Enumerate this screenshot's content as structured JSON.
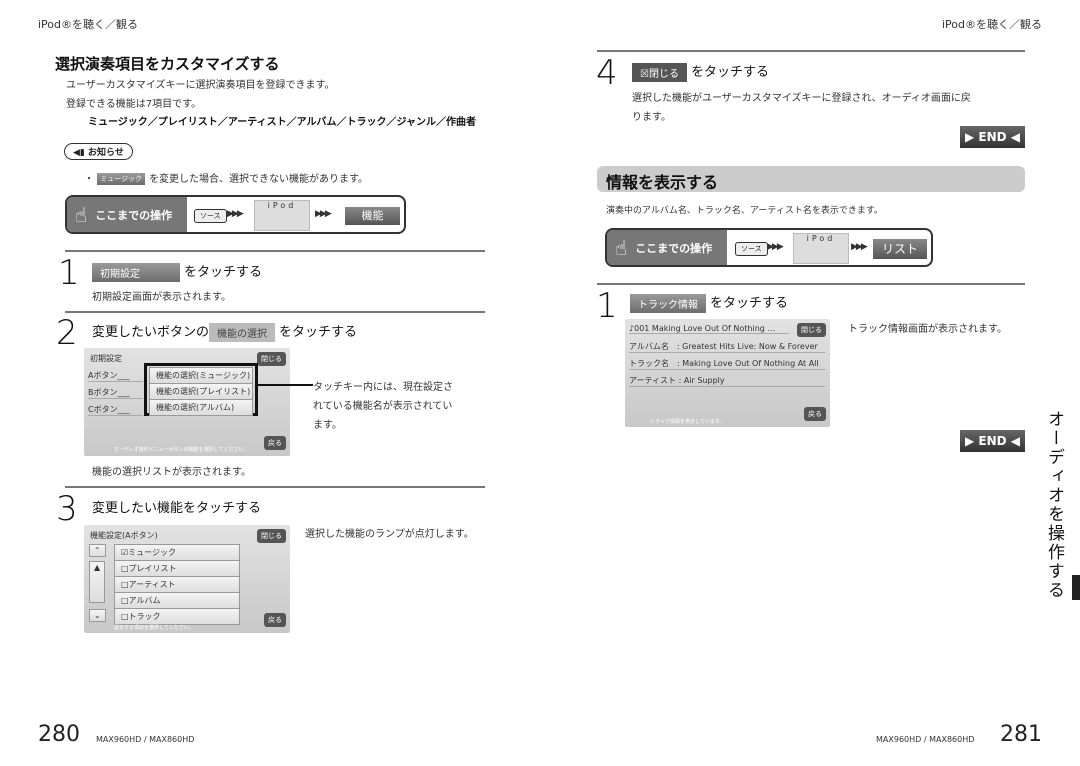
{
  "header": {
    "left": "iPod®を聴く／観る",
    "right": "iPod®を聴く／観る"
  },
  "left": {
    "title": "選択演奏項目をカスタマイズする",
    "intro1": "ユーザーカスタマイズキーに選択演奏項目を登録できます。",
    "intro2": "登録できる機能は7項目です。",
    "functions": "ミュージック／プレイリスト／アーティスト／アルバム／トラック／ジャンル／作曲者",
    "notice_label": "お知らせ",
    "notice_chip": "ミュージック",
    "notice_text": "を変更した場合、選択できない機能があります。",
    "op": {
      "label": "ここまでの操作",
      "source": "ソース",
      "ipod": "iPod",
      "dest": "機能"
    },
    "step1": {
      "num": "1",
      "chip": "初期設定",
      "text": "をタッチする",
      "desc": "初期設定画面が表示されます。"
    },
    "step2": {
      "num": "2",
      "pre": "変更したいボタンの",
      "chip": "機能の選択",
      "text": "をタッチする",
      "desc": "機能の選択リストが表示されます。",
      "callout": [
        "タッチキー内には、現在設定さ",
        "れている機能名が表示されてい",
        "ます。"
      ]
    },
    "screen1": {
      "title": "初期設定",
      "close": "閉じる",
      "rows": [
        "Aボタン___",
        "Bボタン___",
        "Cボタン___"
      ],
      "buttons": [
        "機能の選択(ミュージック)",
        "機能の選択(プレイリスト)",
        "機能の選択(アルバム)"
      ],
      "back": "戻る",
      "hint": "オーディオ操作メニューボタンの機能を選択してください。"
    },
    "step3": {
      "num": "3",
      "text": "変更したい機能をタッチする",
      "desc": "選択した機能のランプが点灯します。"
    },
    "screen2": {
      "title": "機能設定(Aボタン)",
      "close": "閉じる",
      "items": [
        "☑ミュージック",
        "□プレイリスト",
        "□アーティスト",
        "□アルバム",
        "□トラック"
      ],
      "back": "戻る",
      "hint": "設定する項目を選択してください。"
    },
    "page_num": "280",
    "model": "MAX960HD / MAX860HD"
  },
  "right": {
    "step4": {
      "num": "4",
      "chip": "閉じる",
      "text": "をタッチする",
      "desc1": "選択した機能がユーザーカスタマイズキーに登録され、オーディオ画面に戻",
      "desc2": "ります。"
    },
    "end1": "END",
    "section_title": "情報を表示する",
    "intro": "演奏中のアルバム名、トラック名、アーティスト名を表示できます。",
    "op": {
      "label": "ここまでの操作",
      "source": "ソース",
      "ipod": "iPod",
      "dest": "リスト"
    },
    "step1": {
      "num": "1",
      "chip": "トラック情報",
      "text": "をタッチする",
      "desc": "トラック情報画面が表示されます。"
    },
    "screen": {
      "rows": [
        "♪001 Making Love Out Of Nothing …",
        "アルバム名　: Greatest Hits Live: Now & Forever",
        "トラック名　: Making Love Out Of Nothing At All",
        "アーティスト : Air Supply"
      ],
      "close": "閉じる",
      "back": "戻る",
      "hint": "トラック情報を表示しています。"
    },
    "end2": "END",
    "side_tab": "オーディオを操作する",
    "page_num": "281",
    "model": "MAX960HD / MAX860HD"
  }
}
